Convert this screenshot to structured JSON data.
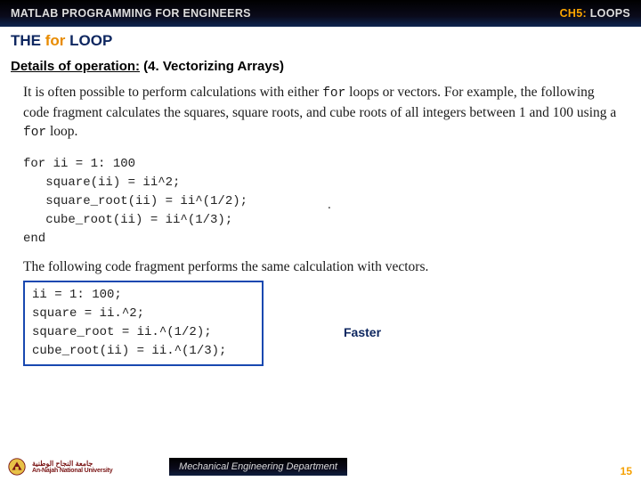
{
  "header": {
    "left": "MATLAB PROGRAMMING FOR ENGINEERS",
    "chapter_prefix": "CH5:",
    "chapter_title": " LOOPS"
  },
  "title": {
    "prefix": "THE ",
    "for_word": "for",
    "suffix": " LOOP"
  },
  "subtitle": {
    "label": "Details of operation:",
    "rest": " (4. Vectorizing Arrays)"
  },
  "body": {
    "para1_a": "It is often possible to perform calculations with either ",
    "para1_code1": "for",
    "para1_b": " loops or vectors. For example, the following code fragment calculates the squares, square roots, and cube roots of all integers between 1 and 100 using a ",
    "para1_code2": "for",
    "para1_c": " loop.",
    "code1": "for ii = 1: 100\n   square(ii) = ii^2;\n   square_root(ii) = ii^(1/2);\n   cube_root(ii) = ii^(1/3);\nend",
    "para2": "The following code fragment performs the same calculation with vectors.",
    "code2": "ii = 1: 100;\nsquare = ii.^2;\nsquare_root = ii.^(1/2);\ncube_root(ii) = ii.^(1/3);",
    "faster": "Faster"
  },
  "footer": {
    "university_ar": "جامعة النجاح الوطنية",
    "university_en": "An-Najah National University",
    "dept": "Mechanical Engineering Department",
    "page": "15"
  }
}
